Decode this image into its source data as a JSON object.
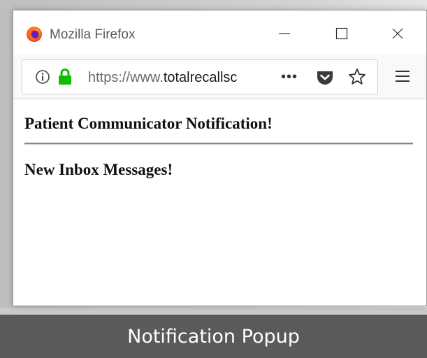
{
  "window": {
    "title": "Mozilla Firefox",
    "icons": {
      "logo": "firefox-logo-icon",
      "minimize": "minimize-icon",
      "maximize": "maximize-icon",
      "close": "close-icon"
    }
  },
  "toolbar": {
    "url_prefix": "https://www.",
    "url_host": "totalrecallsc",
    "icons": {
      "info": "info-icon",
      "lock": "lock-icon",
      "page_actions": "more-dots-icon",
      "pocket": "pocket-icon",
      "bookmark": "star-icon",
      "menu": "hamburger-menu-icon"
    },
    "colors": {
      "lock": "#12bc00",
      "pocket": "#3a3a3f"
    }
  },
  "page": {
    "heading": "Patient Communicator Notification!",
    "subheading": "New Inbox Messages!"
  },
  "caption": {
    "text": "Notification Popup",
    "background": "#5a5a5a"
  }
}
